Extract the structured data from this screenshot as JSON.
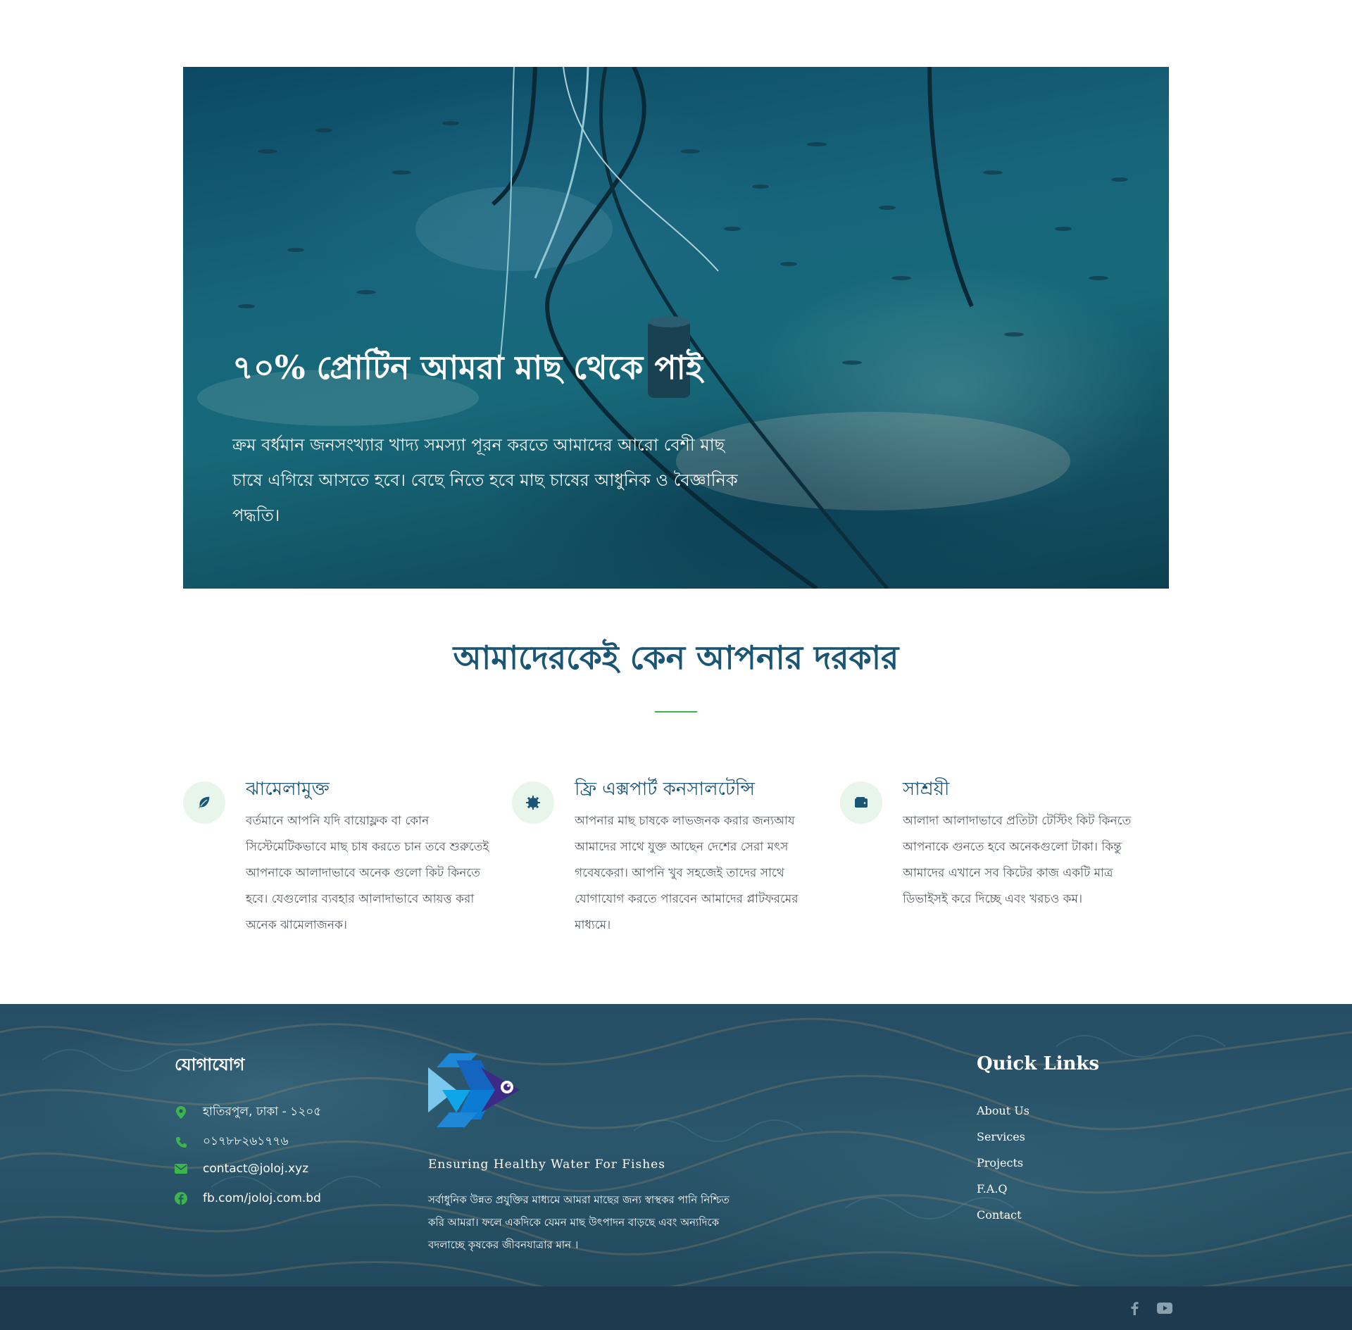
{
  "hero": {
    "title": "৭০% প্রোটিন আমরা মাছ থেকে পাই",
    "text": "ক্রম বর্ধমান জনসংখ্যার খাদ্য সমস্যা পূরন করতে আমাদের আরো বেশী মাছ চাষে এগিয়ে আসতে হবে। বেছে নিতে হবে মাছ চাষের আধুনিক ও বৈজ্ঞানিক পদ্ধতি।"
  },
  "why": {
    "title": "আমাদেরকেই কেন আপনার দরকার"
  },
  "features": [
    {
      "icon": "leaf-icon",
      "title": "ঝামেলামুক্ত",
      "text": "বর্তমানে আপনি যদি বায়োফ্লক বা কোন সিস্টেমেটিকভাবে মাছ চাষ করতে চান তবে শুরুতেই আপনাকে আলাদাভাবে অনেক গুলো কিট কিনতে হবে। যেগুলোর ব্যবহার আলাদাভাবে আয়ত্ত করা অনেক ঝামেলাজনক।"
    },
    {
      "icon": "gear-icon",
      "title": "ফ্রি এক্সপার্ট কনসালটেন্সি",
      "text": "আপনার মাছ চাষকে লাভজনক করার জন্যআয আমাদের সাথে যুক্ত আছেন দেশের সেরা মৎস গবেষকেরা। আপনি খুব সহজেই তাদের সাথে যোগাযোগ করতে পারবেন আমাদের প্লাটফরমের মাধ্যমে।"
    },
    {
      "icon": "wallet-icon",
      "title": "সাশ্রয়ী",
      "text": "আলাদা আলাদাভাবে প্রতিটা টেস্টিং কিট কিনতে আপনাকে গুনতে হবে অনেকগুলো টাকা। কিন্তু আমাদের এখানে সব কিটের কাজ একটি মাত্র ডিভাইসই করে দিচ্ছে এবং খরচও কম।"
    }
  ],
  "footer": {
    "contact_heading": "যোগাযোগ",
    "contacts": [
      {
        "icon": "map-marker-icon",
        "text": "হাতিরপুল, ঢাকা - ১২০৫"
      },
      {
        "icon": "phone-icon",
        "text": "০১৭৮৮২৬১৭৭৬"
      },
      {
        "icon": "envelope-icon",
        "text": "contact@joloj.xyz"
      },
      {
        "icon": "facebook-icon",
        "text": "fb.com/joloj.com.bd"
      }
    ],
    "tagline": "Ensuring Healthy Water For Fishes",
    "about": "সর্বাধুনিক উন্নত প্রযুক্তির মাধ্যমে আমরা মাছের জন্য স্বাস্থকর পানি নিশ্চিত করি আমরা। ফলে একদিকে যেমন মাছ উৎপাদন বাড়ছে এবং অন্যদিকে বদলাচ্ছে কৃষকের জীবনযাত্রার মান ।",
    "links_heading": "Quick Links",
    "links": [
      "About Us",
      "Services",
      "Projects",
      "F.A.Q",
      "Contact"
    ],
    "social": [
      "facebook-icon",
      "youtube-icon"
    ]
  },
  "colors": {
    "accent_green": "#3cb54a",
    "heading_blue": "#1b5575",
    "bottom_bar": "#1d3a4f"
  }
}
